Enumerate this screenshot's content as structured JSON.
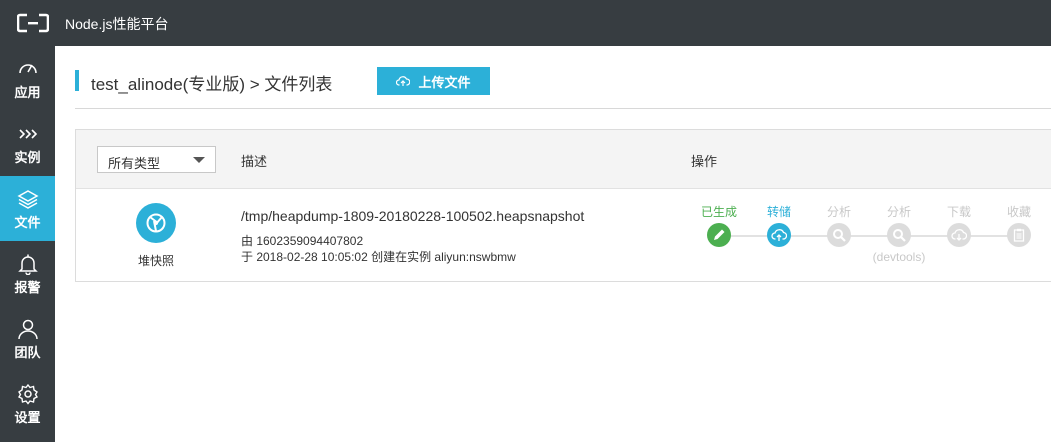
{
  "header": {
    "title": "Node.js性能平台"
  },
  "sidebar": {
    "items": [
      {
        "label": "应用",
        "icon": "speedometer-icon"
      },
      {
        "label": "实例",
        "icon": "chevrons-right-icon"
      },
      {
        "label": "文件",
        "icon": "layers-icon",
        "active": true
      },
      {
        "label": "报警",
        "icon": "bell-icon"
      },
      {
        "label": "团队",
        "icon": "user-icon"
      },
      {
        "label": "设置",
        "icon": "gear-icon"
      }
    ]
  },
  "page": {
    "title": "test_alinode(专业版) > 文件列表",
    "upload_label": "上传文件"
  },
  "table": {
    "filter_value": "所有类型",
    "col_description": "描述",
    "col_actions": "操作",
    "row": {
      "type_label": "堆快照",
      "file_name": "/tmp/heapdump-1809-20180228-100502.heapsnapshot",
      "uploader_line": "由 1602359094407802",
      "created_line": "于 2018-02-28 10:05:02 创建在实例 aliyun:nswbmw",
      "steps": [
        {
          "label": "已生成",
          "state": "done",
          "icon": "pencil-icon"
        },
        {
          "label": "转储",
          "state": "current",
          "icon": "cloud-upload-icon"
        },
        {
          "label": "分析",
          "state": "disabled",
          "icon": "magnifier-icon"
        },
        {
          "label": "分析",
          "state": "disabled",
          "icon": "magnifier-icon",
          "sub": "(devtools)"
        },
        {
          "label": "下载",
          "state": "disabled",
          "icon": "cloud-download-icon"
        },
        {
          "label": "收藏",
          "state": "disabled",
          "icon": "clipboard-icon"
        }
      ]
    }
  },
  "colors": {
    "sidebar_bg": "#373d41",
    "accent": "#2cb0d8",
    "success": "#4caf50"
  }
}
